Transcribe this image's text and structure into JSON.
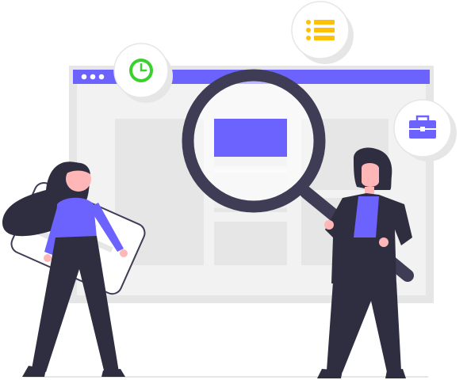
{
  "illustration": {
    "browser_window": {
      "titlebar_dots": 3,
      "content_tiles": 6
    },
    "floating_badges": [
      {
        "icon": "clock-icon"
      },
      {
        "icon": "list-icon"
      },
      {
        "icon": "briefcase-icon"
      }
    ],
    "magnifier": {
      "focused_tile": "highlighted-tile"
    },
    "people": [
      {
        "role": "woman-holding-card"
      },
      {
        "role": "woman-with-magnifier"
      }
    ]
  },
  "colors": {
    "accent": "#6c63ff",
    "dark": "#3f3d56",
    "window_frame": "#e6e6e6",
    "tile": "#e6e6e6",
    "window_body": "#f2f2f2",
    "clock": "#3ad12f",
    "list": "#ffc107",
    "skin": "#ffb6b6",
    "white": "#ffffff"
  }
}
